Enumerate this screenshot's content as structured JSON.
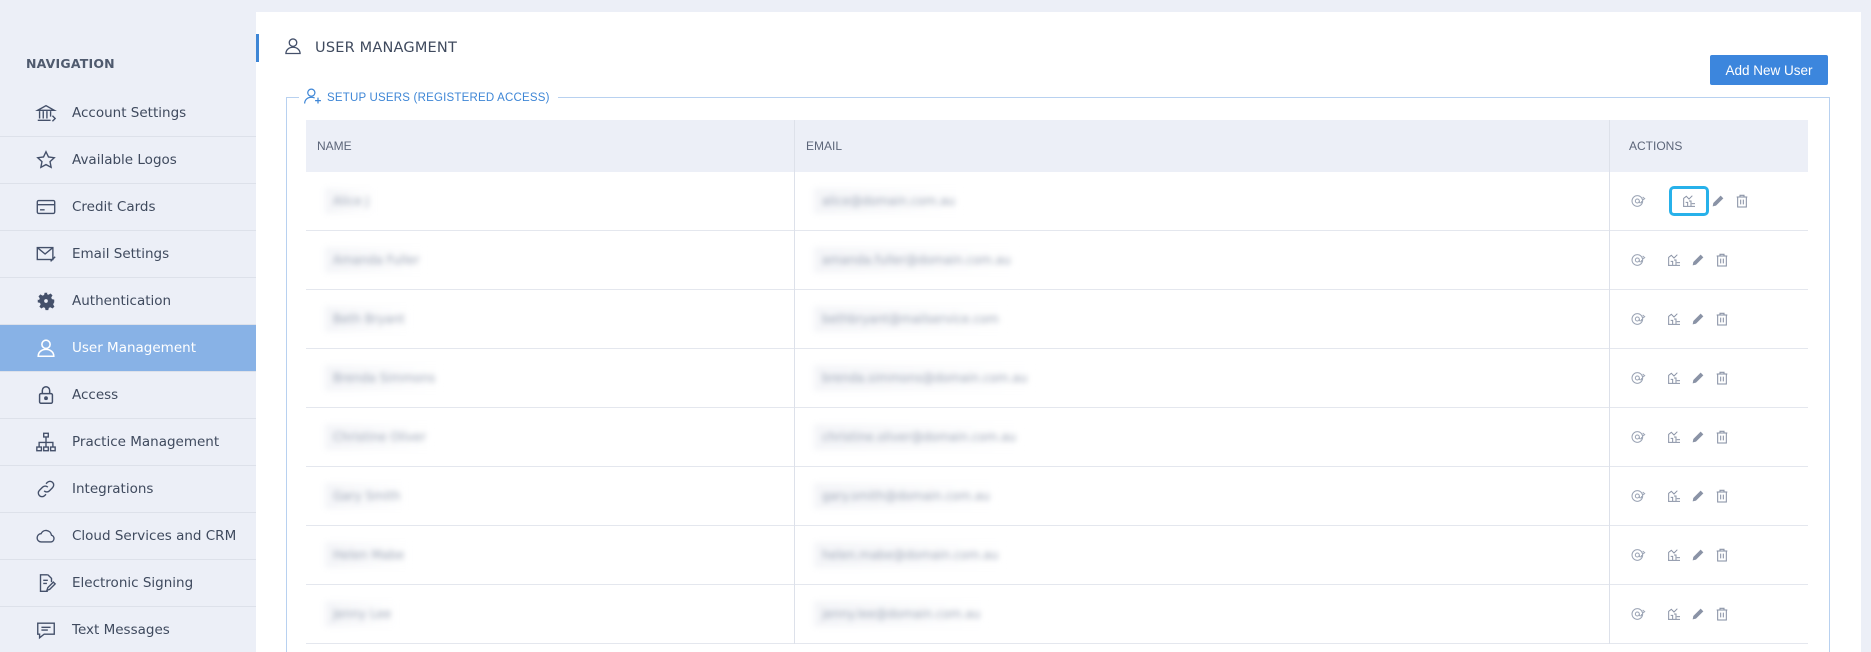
{
  "sidebar": {
    "heading": "NAVIGATION",
    "items": [
      {
        "label": "Account Settings",
        "icon": "bank-icon",
        "active": false
      },
      {
        "label": "Available Logos",
        "icon": "star-icon",
        "active": false
      },
      {
        "label": "Credit Cards",
        "icon": "credit-card-icon",
        "active": false
      },
      {
        "label": "Email Settings",
        "icon": "envelope-icon",
        "active": false
      },
      {
        "label": "Authentication",
        "icon": "gear-icon",
        "active": false
      },
      {
        "label": "User Management",
        "icon": "user-icon",
        "active": true
      },
      {
        "label": "Access",
        "icon": "lock-icon",
        "active": false
      },
      {
        "label": "Practice Management",
        "icon": "org-chart-icon",
        "active": false
      },
      {
        "label": "Integrations",
        "icon": "link-icon",
        "active": false
      },
      {
        "label": "Cloud Services and CRM",
        "icon": "cloud-icon",
        "active": false
      },
      {
        "label": "Electronic Signing",
        "icon": "sign-document-icon",
        "active": false
      },
      {
        "label": "Text Messages",
        "icon": "chat-icon",
        "active": false
      }
    ]
  },
  "header": {
    "title": "USER MANAGMENT",
    "add_button": "Add New User"
  },
  "section": {
    "legend": "SETUP USERS (REGISTERED ACCESS)"
  },
  "table": {
    "columns": [
      "NAME",
      "EMAIL",
      "ACTIONS"
    ],
    "rows": [
      {
        "name": "Alice J",
        "email": "alice@domain.com.au"
      },
      {
        "name": "Amanda Fuller",
        "email": "amanda.fuller@domain.com.au"
      },
      {
        "name": "Beth Bryant",
        "email": "bethbryant@mailservice.com"
      },
      {
        "name": "Brenda Simmons",
        "email": "brenda.simmons@domain.com.au"
      },
      {
        "name": "Christine Oliver",
        "email": "christine.oliver@domain.com.au"
      },
      {
        "name": "Gary Smith",
        "email": "gary.smith@domain.com.au"
      },
      {
        "name": "Helen Mabe",
        "email": "helen.mabe@domain.com.au"
      },
      {
        "name": "Jenny Lee",
        "email": "jenny.lee@domain.com.au"
      }
    ]
  },
  "colors": {
    "accent": "#3c86dd",
    "active_nav": "#88b2e6",
    "highlight": "#27b1ea"
  }
}
